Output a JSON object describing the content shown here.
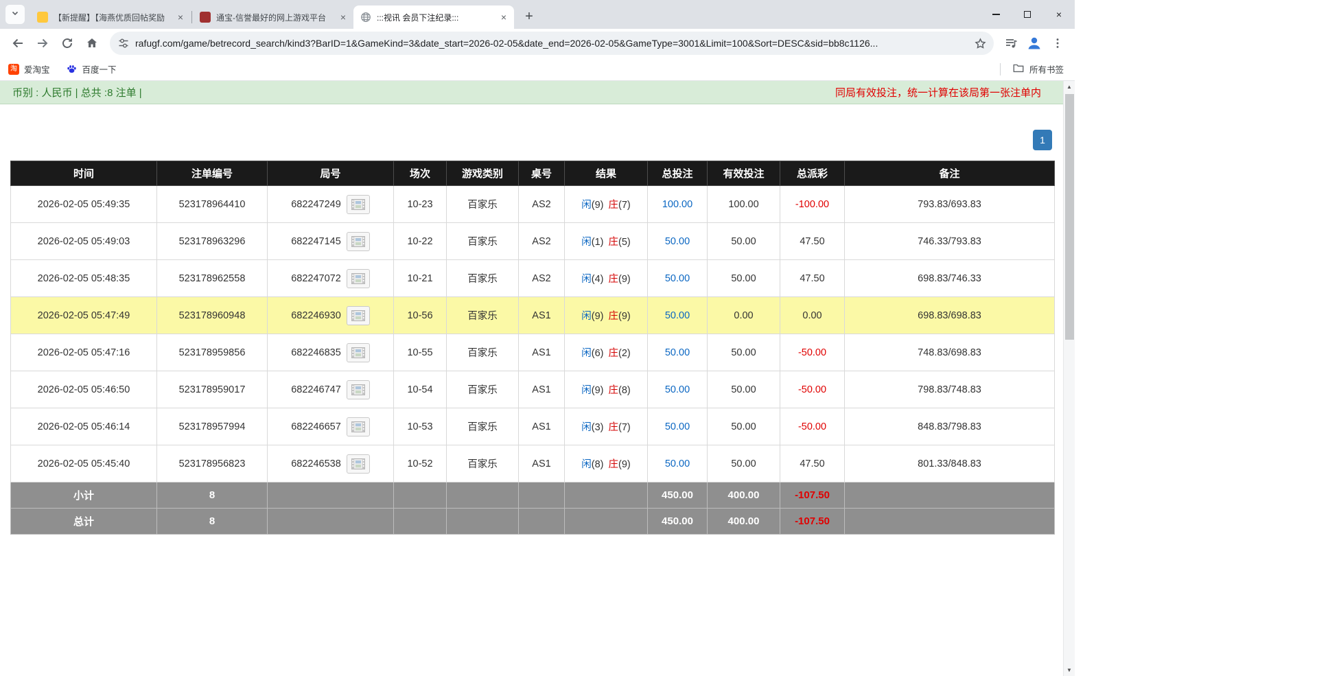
{
  "browser": {
    "tabs": [
      {
        "title": "【新提醒】【海燕优质回帖奖励"
      },
      {
        "title": "通宝-信誉最好的网上游戏平台"
      },
      {
        "title": ":::视讯 会员下注纪录:::"
      }
    ],
    "url": "rafugf.com/game/betrecord_search/kind3?BarID=1&GameKind=3&date_start=2026-02-05&date_end=2026-02-05&GameType=3001&Limit=100&Sort=DESC&sid=bb8c1126...",
    "bookmarks": [
      {
        "label": "爱淘宝",
        "icon_text": "淘"
      },
      {
        "label": "百度一下"
      }
    ],
    "all_bookmarks_label": "所有书签"
  },
  "page": {
    "summary": "币别 : 人民币 | 总共 :8 注单 |",
    "notice": "同局有效投注，统一计算在该局第一张注单内",
    "pagination": {
      "current": "1"
    },
    "table": {
      "headers": [
        "时间",
        "注单编号",
        "局号",
        "场次",
        "游戏类别",
        "桌号",
        "结果",
        "总投注",
        "有效投注",
        "总派彩",
        "备注"
      ],
      "rows": [
        {
          "time": "2026-02-05 05:49:35",
          "bet_id": "523178964410",
          "round_id": "682247249",
          "session": "10-23",
          "game": "百家乐",
          "table_no": "AS2",
          "p_label": "闲",
          "p_val": "(9)",
          "b_label": "庄",
          "b_val": "(7)",
          "total_bet": "100.00",
          "valid_bet": "100.00",
          "payout": "-100.00",
          "payout_neg": true,
          "highlight": false,
          "note": "793.83/693.83"
        },
        {
          "time": "2026-02-05 05:49:03",
          "bet_id": "523178963296",
          "round_id": "682247145",
          "session": "10-22",
          "game": "百家乐",
          "table_no": "AS2",
          "p_label": "闲",
          "p_val": "(1)",
          "b_label": "庄",
          "b_val": "(5)",
          "total_bet": "50.00",
          "valid_bet": "50.00",
          "payout": "47.50",
          "payout_neg": false,
          "highlight": false,
          "note": "746.33/793.83"
        },
        {
          "time": "2026-02-05 05:48:35",
          "bet_id": "523178962558",
          "round_id": "682247072",
          "session": "10-21",
          "game": "百家乐",
          "table_no": "AS2",
          "p_label": "闲",
          "p_val": "(4)",
          "b_label": "庄",
          "b_val": "(9)",
          "total_bet": "50.00",
          "valid_bet": "50.00",
          "payout": "47.50",
          "payout_neg": false,
          "highlight": false,
          "note": "698.83/746.33"
        },
        {
          "time": "2026-02-05 05:47:49",
          "bet_id": "523178960948",
          "round_id": "682246930",
          "session": "10-56",
          "game": "百家乐",
          "table_no": "AS1",
          "p_label": "闲",
          "p_val": "(9)",
          "b_label": "庄",
          "b_val": "(9)",
          "total_bet": "50.00",
          "valid_bet": "0.00",
          "payout": "0.00",
          "payout_neg": false,
          "highlight": true,
          "note": "698.83/698.83"
        },
        {
          "time": "2026-02-05 05:47:16",
          "bet_id": "523178959856",
          "round_id": "682246835",
          "session": "10-55",
          "game": "百家乐",
          "table_no": "AS1",
          "p_label": "闲",
          "p_val": "(6)",
          "b_label": "庄",
          "b_val": "(2)",
          "total_bet": "50.00",
          "valid_bet": "50.00",
          "payout": "-50.00",
          "payout_neg": true,
          "highlight": false,
          "note": "748.83/698.83"
        },
        {
          "time": "2026-02-05 05:46:50",
          "bet_id": "523178959017",
          "round_id": "682246747",
          "session": "10-54",
          "game": "百家乐",
          "table_no": "AS1",
          "p_label": "闲",
          "p_val": "(9)",
          "b_label": "庄",
          "b_val": "(8)",
          "total_bet": "50.00",
          "valid_bet": "50.00",
          "payout": "-50.00",
          "payout_neg": true,
          "highlight": false,
          "note": "798.83/748.83"
        },
        {
          "time": "2026-02-05 05:46:14",
          "bet_id": "523178957994",
          "round_id": "682246657",
          "session": "10-53",
          "game": "百家乐",
          "table_no": "AS1",
          "p_label": "闲",
          "p_val": "(3)",
          "b_label": "庄",
          "b_val": "(7)",
          "total_bet": "50.00",
          "valid_bet": "50.00",
          "payout": "-50.00",
          "payout_neg": true,
          "highlight": false,
          "note": "848.83/798.83"
        },
        {
          "time": "2026-02-05 05:45:40",
          "bet_id": "523178956823",
          "round_id": "682246538",
          "session": "10-52",
          "game": "百家乐",
          "table_no": "AS1",
          "p_label": "闲",
          "p_val": "(8)",
          "b_label": "庄",
          "b_val": "(9)",
          "total_bet": "50.00",
          "valid_bet": "50.00",
          "payout": "47.50",
          "payout_neg": false,
          "highlight": false,
          "note": "801.33/848.83"
        }
      ],
      "subtotal": {
        "label": "小计",
        "count": "8",
        "total_bet": "450.00",
        "valid_bet": "400.00",
        "payout": "-107.50",
        "payout_neg": true
      },
      "total": {
        "label": "总计",
        "count": "8",
        "total_bet": "450.00",
        "valid_bet": "400.00",
        "payout": "-107.50",
        "payout_neg": true
      }
    }
  },
  "colors": {
    "link_blue": "#0a66c2",
    "loss_red": "#e00000",
    "highlight_yellow": "#fbf9a6",
    "header_bg": "#1a1a1a",
    "footer_gray": "#8f8f8f",
    "info_green_bg": "#d8ecd8",
    "info_green_text": "#2d7a2d",
    "pagination_blue": "#337ab7"
  }
}
